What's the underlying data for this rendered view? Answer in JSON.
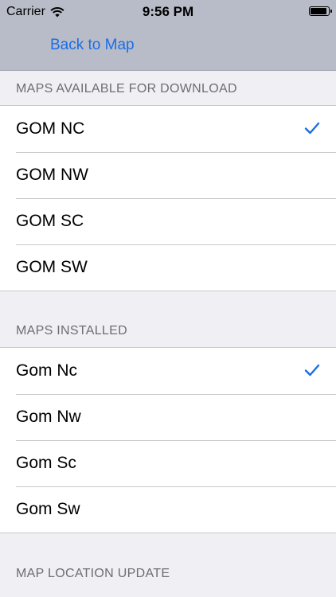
{
  "status_bar": {
    "carrier": "Carrier",
    "time": "9:56 PM",
    "icons": [
      "wifi-icon",
      "battery-icon"
    ]
  },
  "nav": {
    "back_label": "Back to Map"
  },
  "sections": {
    "download": {
      "header": "MAPS AVAILABLE FOR DOWNLOAD",
      "items": [
        {
          "label": "GOM NC",
          "checked": true
        },
        {
          "label": "GOM NW",
          "checked": false
        },
        {
          "label": "GOM SC",
          "checked": false
        },
        {
          "label": "GOM SW",
          "checked": false
        }
      ]
    },
    "installed": {
      "header": "MAPS INSTALLED",
      "items": [
        {
          "label": "Gom Nc",
          "checked": true
        },
        {
          "label": "Gom Nw",
          "checked": false
        },
        {
          "label": "Gom Sc",
          "checked": false
        },
        {
          "label": "Gom Sw",
          "checked": false
        }
      ]
    },
    "location": {
      "header": "MAP LOCATION UPDATE"
    }
  },
  "colors": {
    "accent": "#1a6ee6",
    "bar_background": "#b8bcc8",
    "group_background": "#efeff4"
  }
}
